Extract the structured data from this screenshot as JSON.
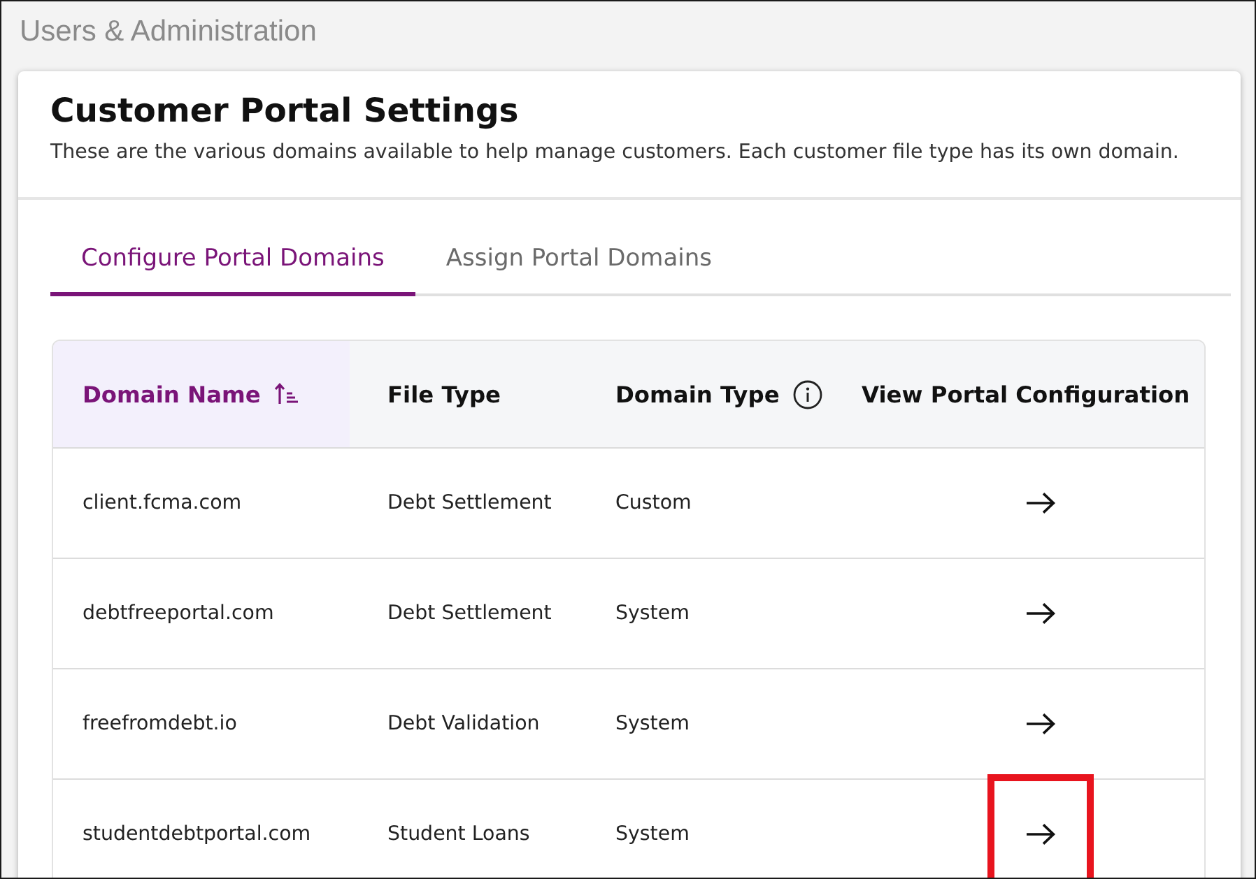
{
  "breadcrumb": "Users & Administration",
  "card": {
    "title": "Customer Portal Settings",
    "description": "These are the various domains available to help manage customers. Each customer file type has its own domain."
  },
  "tabs": [
    {
      "label": "Configure Portal Domains",
      "selected": true
    },
    {
      "label": "Assign Portal Domains",
      "selected": false
    }
  ],
  "table": {
    "columns": [
      {
        "label": "Domain Name",
        "sorted": true,
        "info": false
      },
      {
        "label": "File Type",
        "sorted": false,
        "info": false
      },
      {
        "label": "Domain Type",
        "sorted": false,
        "info": true
      },
      {
        "label": "View Portal Configuration",
        "sorted": false,
        "info": false
      }
    ],
    "rows": [
      {
        "domain_name": "client.fcma.com",
        "file_type": "Debt Settlement",
        "domain_type": "Custom",
        "highlighted": false
      },
      {
        "domain_name": "debtfreeportal.com",
        "file_type": "Debt Settlement",
        "domain_type": "System",
        "highlighted": false
      },
      {
        "domain_name": "freefromdebt.io",
        "file_type": "Debt Validation",
        "domain_type": "System",
        "highlighted": false
      },
      {
        "domain_name": "studentdebtportal.com",
        "file_type": "Student Loans",
        "domain_type": "System",
        "highlighted": true
      }
    ]
  }
}
